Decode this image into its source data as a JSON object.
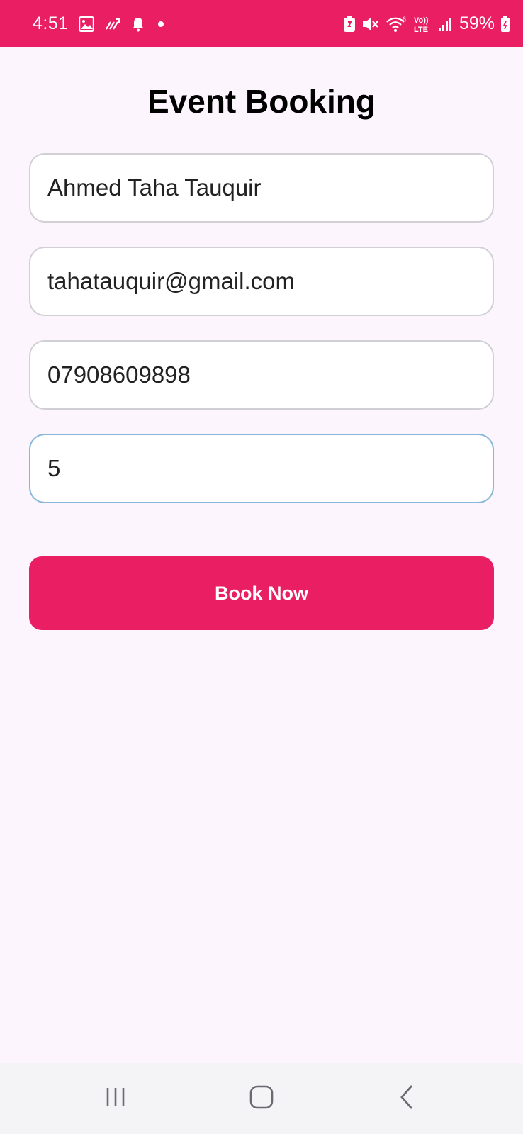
{
  "status_bar": {
    "time": "4:51",
    "battery_percent": "59%",
    "background_color": "#e91e63",
    "left_icons": [
      "image-icon",
      "sync-icon",
      "bell-icon",
      "dot-icon"
    ],
    "right_icons": [
      "battery-saver-icon",
      "mute-icon",
      "wifi-icon",
      "volte-icon",
      "signal-icon",
      "battery-icon"
    ]
  },
  "page": {
    "title": "Event Booking",
    "background_color": "#fcf5fd"
  },
  "form": {
    "name": {
      "value": "Ahmed Taha Tauquir"
    },
    "email": {
      "value": "tahatauquir@gmail.com"
    },
    "phone": {
      "value": "07908609898"
    },
    "tickets": {
      "value": "5",
      "focused": true
    }
  },
  "actions": {
    "book_label": "Book Now",
    "accent_color": "#e91e63"
  },
  "nav_bar": {
    "items": [
      "recent-apps-icon",
      "home-icon",
      "back-icon"
    ]
  }
}
